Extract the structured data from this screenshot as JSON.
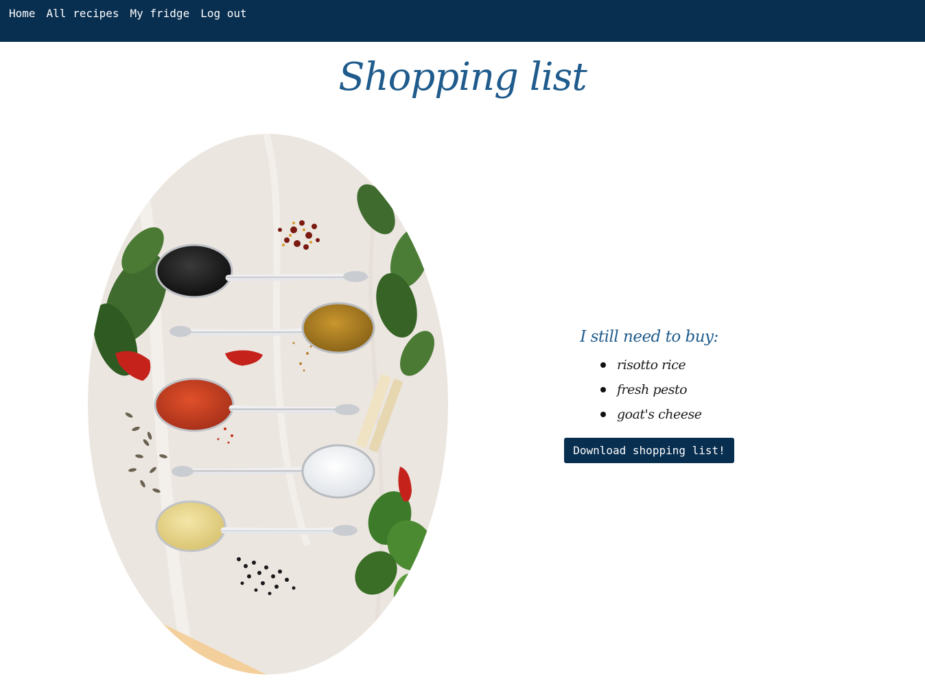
{
  "nav": {
    "items": [
      {
        "label": "Home"
      },
      {
        "label": "All recipes"
      },
      {
        "label": "My fridge"
      },
      {
        "label": "Log out"
      }
    ]
  },
  "page": {
    "title": "Shopping list"
  },
  "image": {
    "icon": "spices-photo"
  },
  "shopping": {
    "heading": "I still need to buy:",
    "items": [
      {
        "label": "risotto rice"
      },
      {
        "label": "fresh pesto"
      },
      {
        "label": "goat's cheese"
      }
    ],
    "download_label": "Download shopping list!"
  },
  "colors": {
    "nav_bg": "#082e50",
    "title": "#1f5b8c",
    "button_bg": "#082e50"
  }
}
